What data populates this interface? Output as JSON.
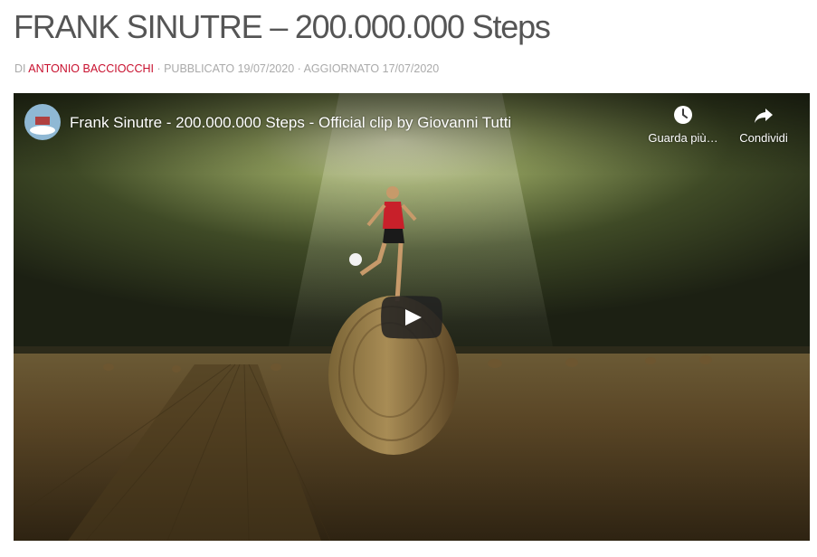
{
  "post": {
    "title": "FRANK SINUTRE – 200.000.000 Steps",
    "meta_prefix": "DI ",
    "author": "ANTONIO BACCIOCCHI",
    "meta_rest": " · PUBBLICATO 19/07/2020 · AGGIORNATO 17/07/2020"
  },
  "video": {
    "title": "Frank Sinutre - 200.000.000 Steps - Official clip by Giovanni Tutti",
    "watch_later_label": "Guarda più…",
    "share_label": "Condividi",
    "watch_later_icon": "clock-icon",
    "share_icon": "share-arrow-icon",
    "play_icon": "play-icon",
    "play_button_color": "#212121",
    "link_color": "#c8102e"
  }
}
